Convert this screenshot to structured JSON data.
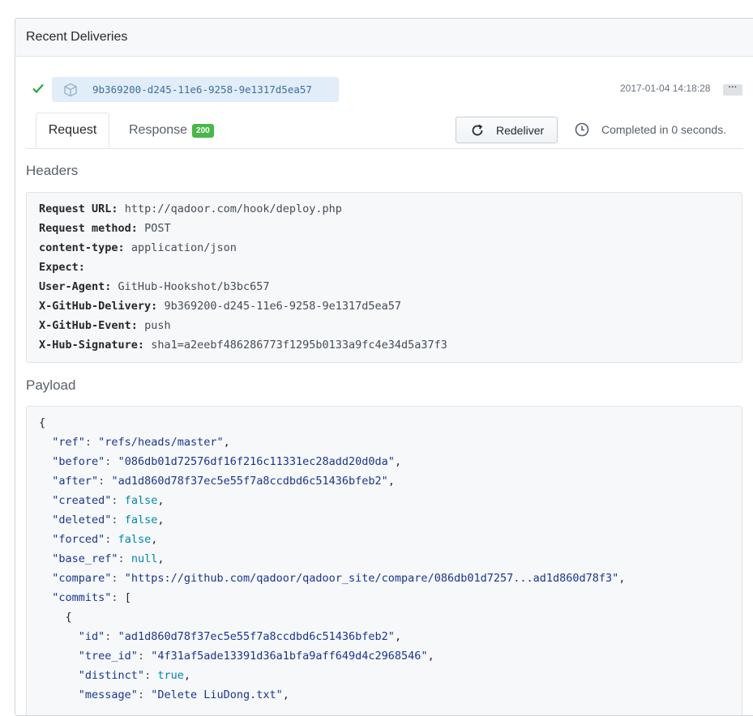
{
  "panel": {
    "title": "Recent Deliveries"
  },
  "delivery": {
    "guid": "9b369200-d245-11e6-9258-9e1317d5ea57",
    "timestamp": "2017-01-04 14:18:28",
    "more_label": "···"
  },
  "tabs": {
    "request_label": "Request",
    "response_label": "Response",
    "response_status": "200"
  },
  "actions": {
    "redeliver_label": "Redeliver",
    "completed_text": "Completed in 0 seconds."
  },
  "headers_section": {
    "title": "Headers",
    "rows": [
      {
        "key": "Request URL:",
        "value": "http://qadoor.com/hook/deploy.php"
      },
      {
        "key": "Request method:",
        "value": "POST"
      },
      {
        "key": "content-type:",
        "value": "application/json"
      },
      {
        "key": "Expect:",
        "value": ""
      },
      {
        "key": "User-Agent:",
        "value": "GitHub-Hookshot/b3bc657"
      },
      {
        "key": "X-GitHub-Delivery:",
        "value": "9b369200-d245-11e6-9258-9e1317d5ea57"
      },
      {
        "key": "X-GitHub-Event:",
        "value": "push"
      },
      {
        "key": "X-Hub-Signature:",
        "value": "sha1=a2eebf486286773f1295b0133a9fc4e34d5a37f3"
      }
    ]
  },
  "payload_section": {
    "title": "Payload",
    "lines": [
      {
        "indent": "",
        "key": "",
        "value": "",
        "type": "punc",
        "text": "{"
      },
      {
        "indent": "  ",
        "key": "\"ref\"",
        "value": "\"refs/heads/master\"",
        "type": "str",
        "suffix": ","
      },
      {
        "indent": "  ",
        "key": "\"before\"",
        "value": "\"086db01d72576df16f216c11331ec28add20d0da\"",
        "type": "str",
        "suffix": ","
      },
      {
        "indent": "  ",
        "key": "\"after\"",
        "value": "\"ad1d860d78f37ec5e55f7a8ccdbd6c51436bfeb2\"",
        "type": "str",
        "suffix": ","
      },
      {
        "indent": "  ",
        "key": "\"created\"",
        "value": "false",
        "type": "lit",
        "suffix": ","
      },
      {
        "indent": "  ",
        "key": "\"deleted\"",
        "value": "false",
        "type": "lit",
        "suffix": ","
      },
      {
        "indent": "  ",
        "key": "\"forced\"",
        "value": "false",
        "type": "lit",
        "suffix": ","
      },
      {
        "indent": "  ",
        "key": "\"base_ref\"",
        "value": "null",
        "type": "lit",
        "suffix": ","
      },
      {
        "indent": "  ",
        "key": "\"compare\"",
        "value": "\"https://github.com/qadoor/qadoor_site/compare/086db01d7257...ad1d860d78f3\"",
        "type": "str",
        "suffix": ","
      },
      {
        "indent": "  ",
        "key": "\"commits\"",
        "value": "[",
        "type": "punc",
        "suffix": ""
      },
      {
        "indent": "    ",
        "key": "",
        "value": "",
        "type": "punc",
        "text": "{"
      },
      {
        "indent": "      ",
        "key": "\"id\"",
        "value": "\"ad1d860d78f37ec5e55f7a8ccdbd6c51436bfeb2\"",
        "type": "str",
        "suffix": ","
      },
      {
        "indent": "      ",
        "key": "\"tree_id\"",
        "value": "\"4f31af5ade13391d36a1bfa9aff649d4c2968546\"",
        "type": "str",
        "suffix": ","
      },
      {
        "indent": "      ",
        "key": "\"distinct\"",
        "value": "true",
        "type": "lit",
        "suffix": ","
      },
      {
        "indent": "      ",
        "key": "\"message\"",
        "value": "\"Delete LiuDong.txt\"",
        "type": "str",
        "suffix": ","
      }
    ]
  }
}
